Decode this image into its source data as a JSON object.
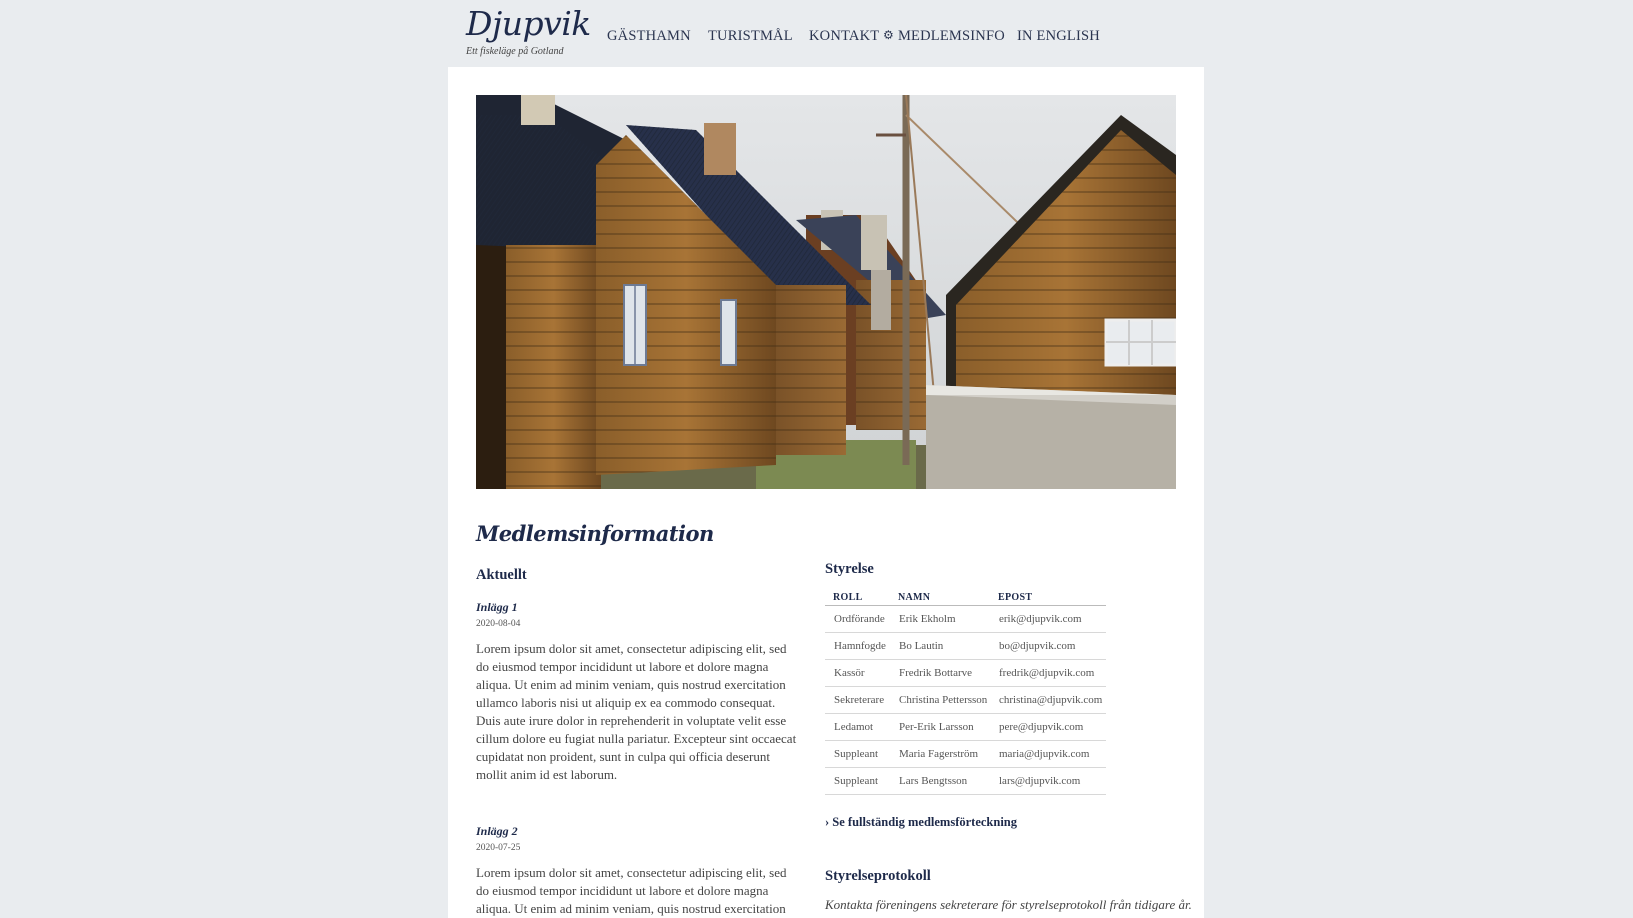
{
  "header": {
    "logo_title": "Djupvik",
    "logo_subtitle": "Ett fiskeläge på Gotland",
    "nav": [
      {
        "label": "GÄSTHAMN"
      },
      {
        "label": "TURISTMÅL"
      },
      {
        "label": "KONTAKT"
      },
      {
        "label": "MEDLEMSINFO",
        "icon": "gear-icon"
      },
      {
        "label": "IN ENGLISH"
      }
    ]
  },
  "main": {
    "page_title": "Medlemsinformation",
    "news": {
      "heading": "Aktuellt",
      "posts": [
        {
          "title": "Inlägg 1",
          "date": "2020-08-04",
          "body": "Lorem ipsum dolor sit amet, consectetur adipiscing elit, sed do eiusmod tempor incididunt ut labore et dolore magna aliqua. Ut enim ad minim veniam, quis nostrud exercitation ullamco laboris nisi ut aliquip ex ea commodo consequat. Duis aute irure dolor in reprehenderit in voluptate velit esse cillum dolore eu fugiat nulla pariatur. Excepteur sint occaecat cupidatat non proident, sunt in culpa qui officia deserunt mollit anim id est laborum."
        },
        {
          "title": "Inlägg 2",
          "date": "2020-07-25",
          "body": "Lorem ipsum dolor sit amet, consectetur adipiscing elit, sed do eiusmod tempor incididunt ut labore et dolore magna aliqua. Ut enim ad minim veniam, quis nostrud exercitation ullamco laboris nisi ut aliquip ex ea commodo consequat. Duis aute irure dolor in"
        }
      ]
    },
    "board": {
      "heading": "Styrelse",
      "columns": [
        "ROLL",
        "NAMN",
        "EPOST"
      ],
      "rows": [
        [
          "Ordförande",
          "Erik Ekholm",
          "erik@djupvik.com"
        ],
        [
          "Hamnfogde",
          "Bo Lautin",
          "bo@djupvik.com"
        ],
        [
          "Kassör",
          "Fredrik Bottarve",
          "fredrik@djupvik.com"
        ],
        [
          "Sekreterare",
          "Christina Pettersson",
          "christina@djupvik.com"
        ],
        [
          "Ledamot",
          "Per-Erik Larsson",
          "pere@djupvik.com"
        ],
        [
          "Suppleant",
          "Maria Fagerström",
          "maria@djupvik.com"
        ],
        [
          "Suppleant",
          "Lars Bengtsson",
          "lars@djupvik.com"
        ]
      ],
      "more_link": "› Se fullständig medlemsförteckning"
    },
    "protocol": {
      "heading": "Styrelseprotokoll",
      "note": "Kontakta föreningens sekreterare för styrelseprotokoll från tidigare år."
    }
  },
  "colors": {
    "background": "#e9ecef",
    "content": "#ffffff",
    "heading": "#1e2a4a"
  }
}
